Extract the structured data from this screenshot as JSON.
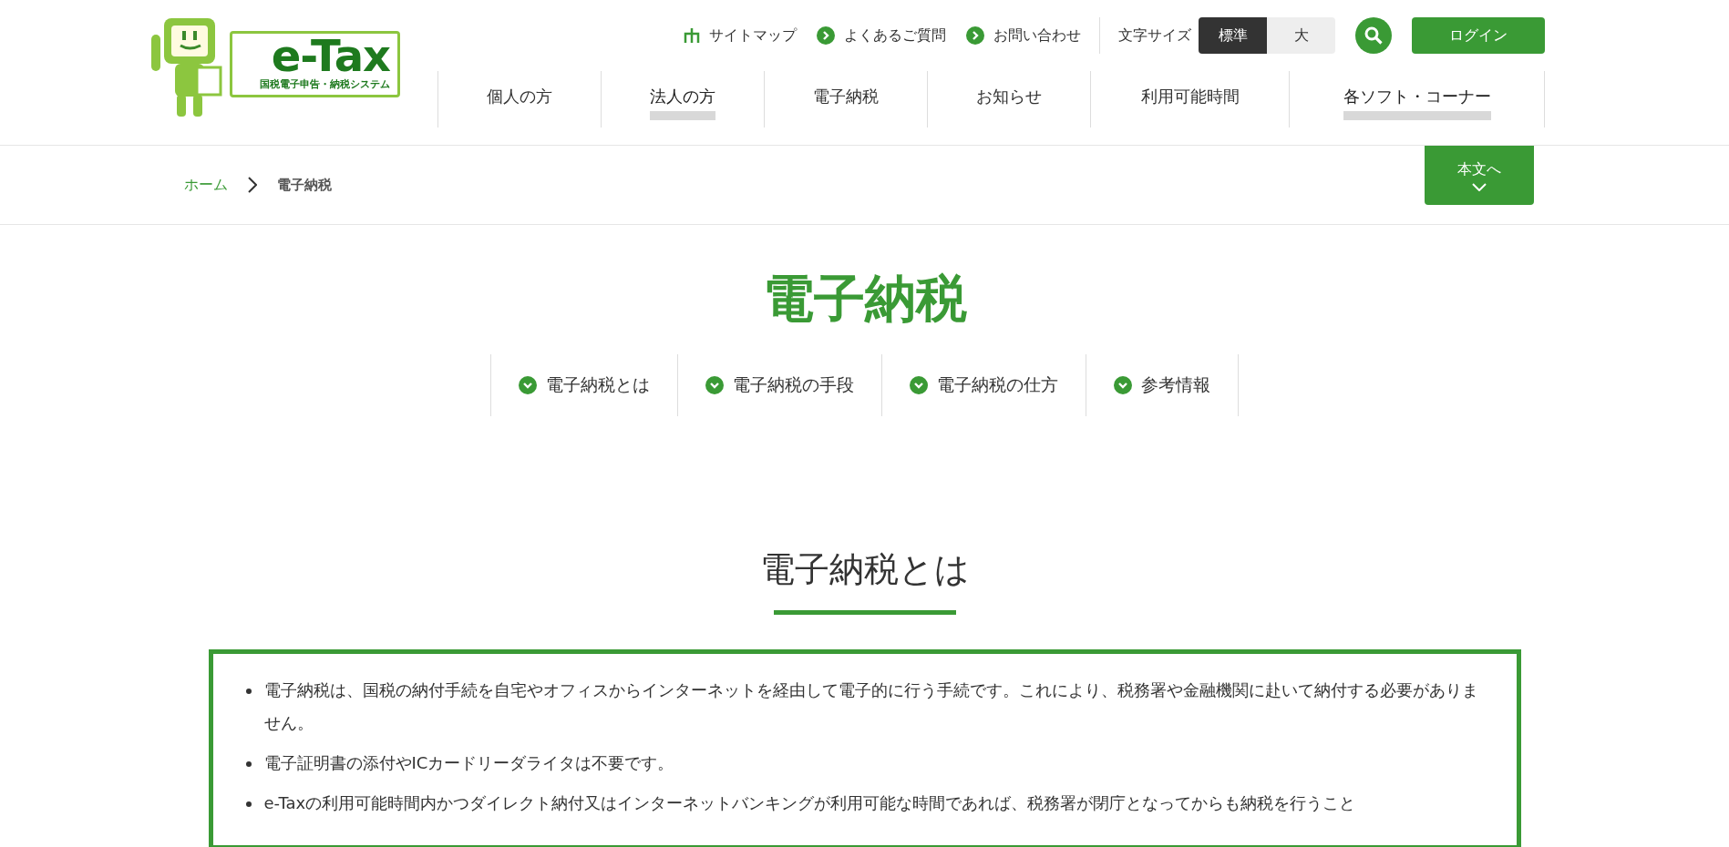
{
  "logo": {
    "title": "e-Tax",
    "subtitle": "国税電子申告・納税システム"
  },
  "utility_links": [
    {
      "label": "サイトマップ",
      "kind": "sitemap"
    },
    {
      "label": "よくあるご質問",
      "kind": "arrow"
    },
    {
      "label": "お問い合わせ",
      "kind": "arrow"
    }
  ],
  "text_size": {
    "label": "文字サイズ",
    "options": [
      {
        "label": "標準",
        "selected": true
      },
      {
        "label": "大",
        "selected": false
      }
    ]
  },
  "login_button": "ログイン",
  "main_nav": [
    {
      "label": "個人の方",
      "highlighted": false
    },
    {
      "label": "法人の方",
      "highlighted": true
    },
    {
      "label": "電子納税",
      "highlighted": false
    },
    {
      "label": "お知らせ",
      "highlighted": false
    },
    {
      "label": "利用可能時間",
      "highlighted": false
    },
    {
      "label": "各ソフト・コーナー",
      "highlighted": true
    }
  ],
  "breadcrumb": [
    {
      "label": "ホーム",
      "current": false
    },
    {
      "label": "電子納税",
      "current": true
    }
  ],
  "skip_button": "本文へ",
  "page_title": "電子納税",
  "anchor_links": [
    "電子納税とは",
    "電子納税の手段",
    "電子納税の仕方",
    "参考情報"
  ],
  "section": {
    "heading": "電子納税とは",
    "bullets": [
      "電子納税は、国税の納付手続を自宅やオフィスからインターネットを経由して電子的に行う手続です。これにより、税務署や金融機関に赴いて納付する必要がありません。",
      "電子証明書の添付やICカードリーダライタは不要です。",
      "e-Taxの利用可能時間内かつダイレクト納付又はインターネットバンキングが利用可能な時間であれば、税務署が閉庁となってからも納税を行うこと"
    ]
  }
}
